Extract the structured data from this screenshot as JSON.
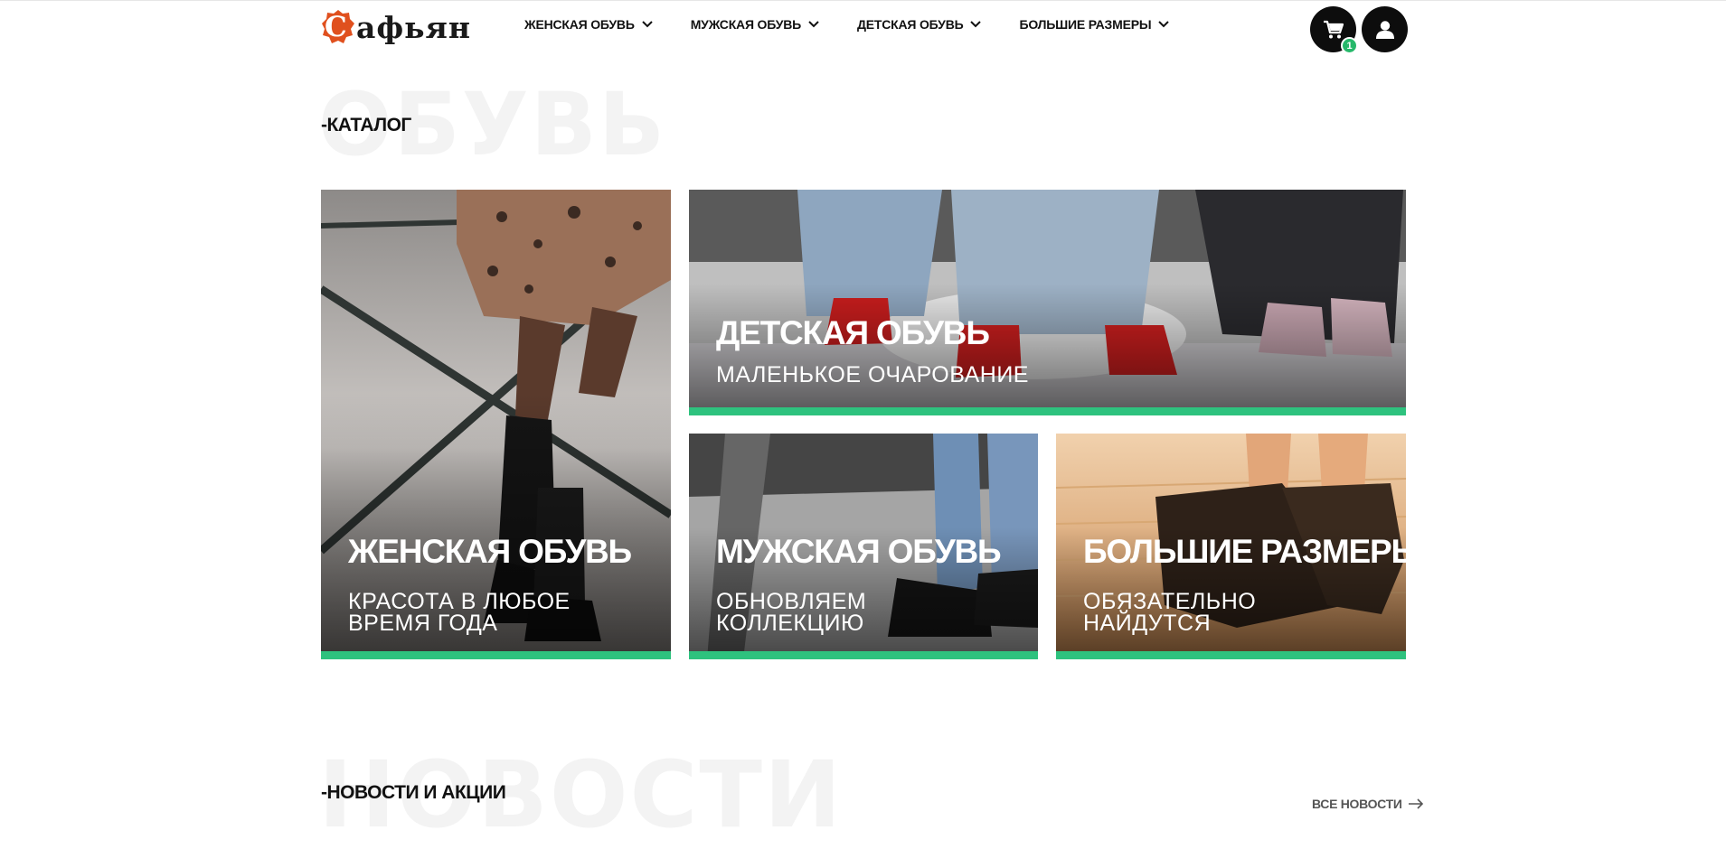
{
  "header": {
    "brand_letter": "С",
    "brand_rest": "афьян",
    "nav": [
      {
        "label": "ЖЕНСКАЯ ОБУВЬ"
      },
      {
        "label": "МУЖСКАЯ ОБУВЬ"
      },
      {
        "label": "ДЕТСКАЯ ОБУВЬ"
      },
      {
        "label": "БОЛЬШИЕ РАЗМЕРЫ"
      }
    ],
    "cart_count": "1",
    "icons": {
      "cart": "cart-icon",
      "user": "user-icon",
      "chevron": "chevron-down-icon"
    }
  },
  "catalog": {
    "ghost": "ОБУВЬ",
    "title": "-КАТАЛОГ",
    "tiles": {
      "women": {
        "title": "ЖЕНСКАЯ ОБУВЬ",
        "sub1": "КРАСОТА В ЛЮБОЕ",
        "sub2": "ВРЕМЯ ГОДА"
      },
      "kids": {
        "title": "ДЕТСКАЯ ОБУВЬ",
        "sub1": "МАЛЕНЬКОЕ ОЧАРОВАНИЕ"
      },
      "men": {
        "title": "МУЖСКАЯ ОБУВЬ",
        "sub1": "ОБНОВЛЯЕМ",
        "sub2": "КОЛЛЕКЦИЮ"
      },
      "big": {
        "title": "БОЛЬШИЕ РАЗМЕРЫ",
        "sub1": "ОБЯЗАТЕЛЬНО",
        "sub2": "НАЙДУТСЯ"
      }
    }
  },
  "news": {
    "ghost": "НОВОСТИ",
    "title": "-НОВОСТИ И АКЦИИ",
    "all_link": "ВСЕ НОВОСТИ"
  },
  "colors": {
    "accent": "#2ec27e",
    "brand": "#e0501e",
    "badge": "#26b86a"
  }
}
